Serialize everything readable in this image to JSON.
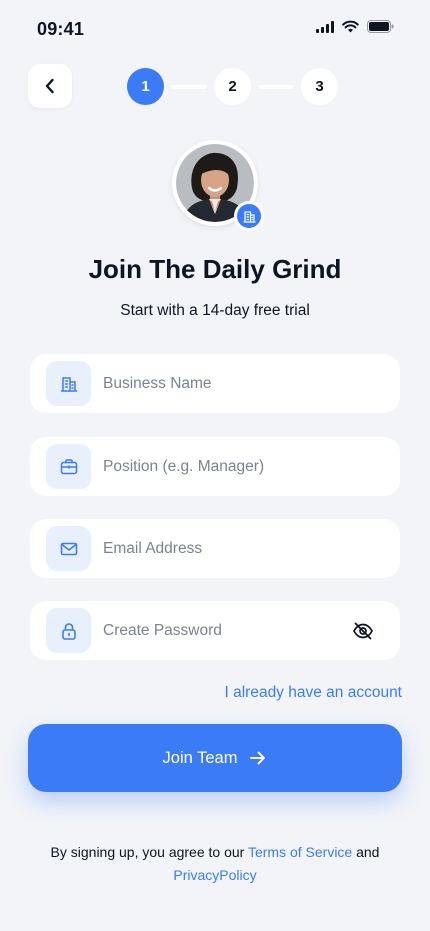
{
  "status_bar": {
    "time": "09:41"
  },
  "stepper": {
    "steps": [
      "1",
      "2",
      "3"
    ],
    "active_step": 1
  },
  "header": {
    "title": "Join The Daily Grind",
    "subtitle": "Start with a 14-day free trial"
  },
  "form": {
    "business_name": {
      "placeholder": "Business Name",
      "value": "",
      "icon": "building-icon"
    },
    "position": {
      "placeholder": "Position (e.g. Manager)",
      "value": "",
      "icon": "briefcase-icon"
    },
    "email": {
      "placeholder": "Email Address",
      "value": "",
      "icon": "mail-icon"
    },
    "password": {
      "placeholder": "Create Password",
      "value": "",
      "icon": "lock-icon",
      "toggle_icon": "eye-off-icon"
    }
  },
  "login_link": "I already have an account",
  "join_button": {
    "label": "Join Team",
    "icon": "arrow-right-icon"
  },
  "terms": {
    "prefix": "By signing up, you agree to our ",
    "terms_link": "Terms of Service",
    "conjunction": " and",
    "privacy_link": "PrivacyPolicy"
  },
  "colors": {
    "accent": "#3b7cf6",
    "background": "#f2f4f8",
    "field_icon_bg": "#e8effd",
    "text": "#0f1422"
  }
}
